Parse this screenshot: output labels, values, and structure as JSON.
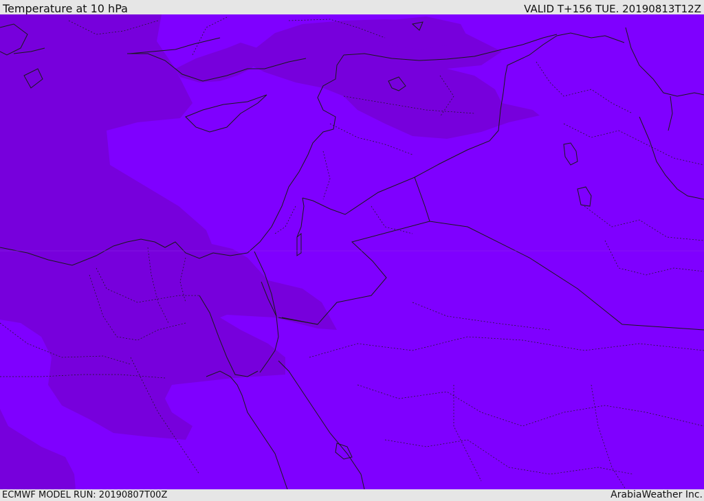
{
  "header": {
    "title": "Temperature at 10 hPa",
    "valid_time": "VALID T+156 TUE. 20190813T12Z"
  },
  "footer": {
    "model_run": "ECMWF MODEL RUN: 20190807T00Z",
    "credit": "ArabiaWeather Inc."
  },
  "colors": {
    "warmer_band": "#7f00ff",
    "cooler_band": "#7700dc",
    "coastline": "#1a1a1a",
    "borders": "#1a1a1a",
    "bar_background": "#e6e6e6"
  }
}
